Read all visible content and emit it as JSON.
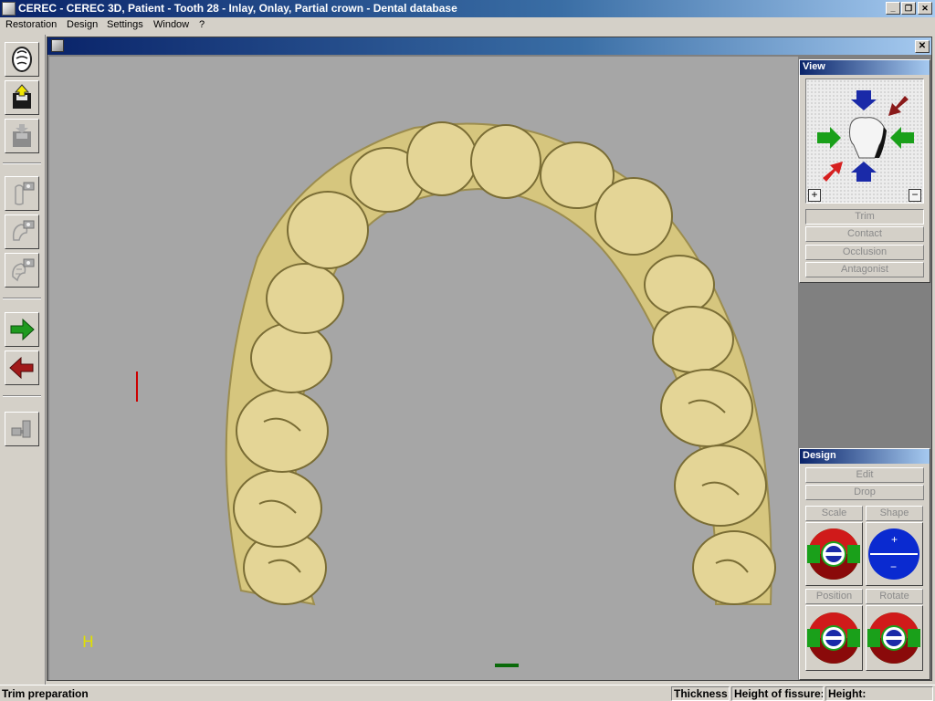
{
  "window": {
    "title": "CEREC - CEREC 3D, Patient - Tooth  28 - Inlay, Onlay, Partial crown - Dental database",
    "minimize_glyph": "_",
    "restore_glyph": "❐",
    "close_glyph": "✕"
  },
  "menu": {
    "items": [
      "Restoration",
      "Design",
      "Settings",
      "Window",
      "?"
    ]
  },
  "toolbar": {
    "icons": [
      "tooth-arch-icon",
      "export-icon",
      "import-icon",
      "camera-tooth-icon",
      "camera-arch-icon",
      "camera-bite-icon",
      "next-arrow-icon",
      "back-arrow-icon",
      "connector-icon"
    ]
  },
  "doc": {
    "close_glyph": "✕"
  },
  "view_panel": {
    "title": "View",
    "zoom_in": "+",
    "zoom_out": "−",
    "buttons": [
      "Trim",
      "Contact",
      "Occlusion",
      "Antagonist"
    ]
  },
  "design_panel": {
    "title": "Design",
    "edit": "Edit",
    "drop": "Drop",
    "scale": "Scale",
    "shape": "Shape",
    "position": "Position",
    "rotate": "Rotate",
    "shape_plus": "+",
    "shape_minus": "−"
  },
  "viewport": {
    "corner_marker": "H",
    "background": "#a6a6a6",
    "model_color": "#e3d595"
  },
  "status": {
    "left": "Trim preparation",
    "thickness": "Thickness:",
    "fissure": "Height of fissure:",
    "height": "Height:"
  }
}
